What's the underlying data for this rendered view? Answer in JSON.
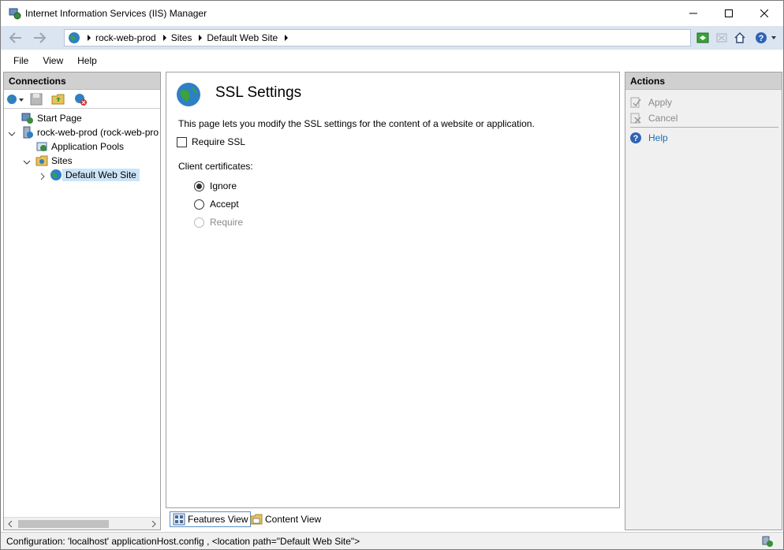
{
  "window": {
    "title": "Internet Information Services (IIS) Manager"
  },
  "address": {
    "crumbs": [
      "rock-web-prod",
      "Sites",
      "Default Web Site"
    ]
  },
  "menu": {
    "items": [
      "File",
      "View",
      "Help"
    ]
  },
  "connections": {
    "header": "Connections",
    "tree": {
      "start_page": "Start Page",
      "server": "rock-web-prod (rock-web-pro",
      "app_pools": "Application Pools",
      "sites": "Sites",
      "default_site": "Default Web Site"
    }
  },
  "content": {
    "title": "SSL Settings",
    "description": "This page lets you modify the SSL settings for the content of a website or application.",
    "require_ssl_label": "Require SSL",
    "require_ssl_checked": false,
    "client_certs_label": "Client certificates:",
    "radios": [
      {
        "label": "Ignore",
        "selected": true,
        "enabled": true
      },
      {
        "label": "Accept",
        "selected": false,
        "enabled": true
      },
      {
        "label": "Require",
        "selected": false,
        "enabled": false
      }
    ]
  },
  "views": {
    "features": "Features View",
    "content": "Content View"
  },
  "actions": {
    "header": "Actions",
    "apply": "Apply",
    "cancel": "Cancel",
    "help": "Help"
  },
  "status": {
    "text": "Configuration: 'localhost' applicationHost.config , <location path=\"Default Web Site\">"
  },
  "colors": {
    "accent": "#1a6fb5",
    "pane_header": "#d0d0d0",
    "address_bg": "#dbe4f1",
    "selection": "#cce4f7"
  }
}
